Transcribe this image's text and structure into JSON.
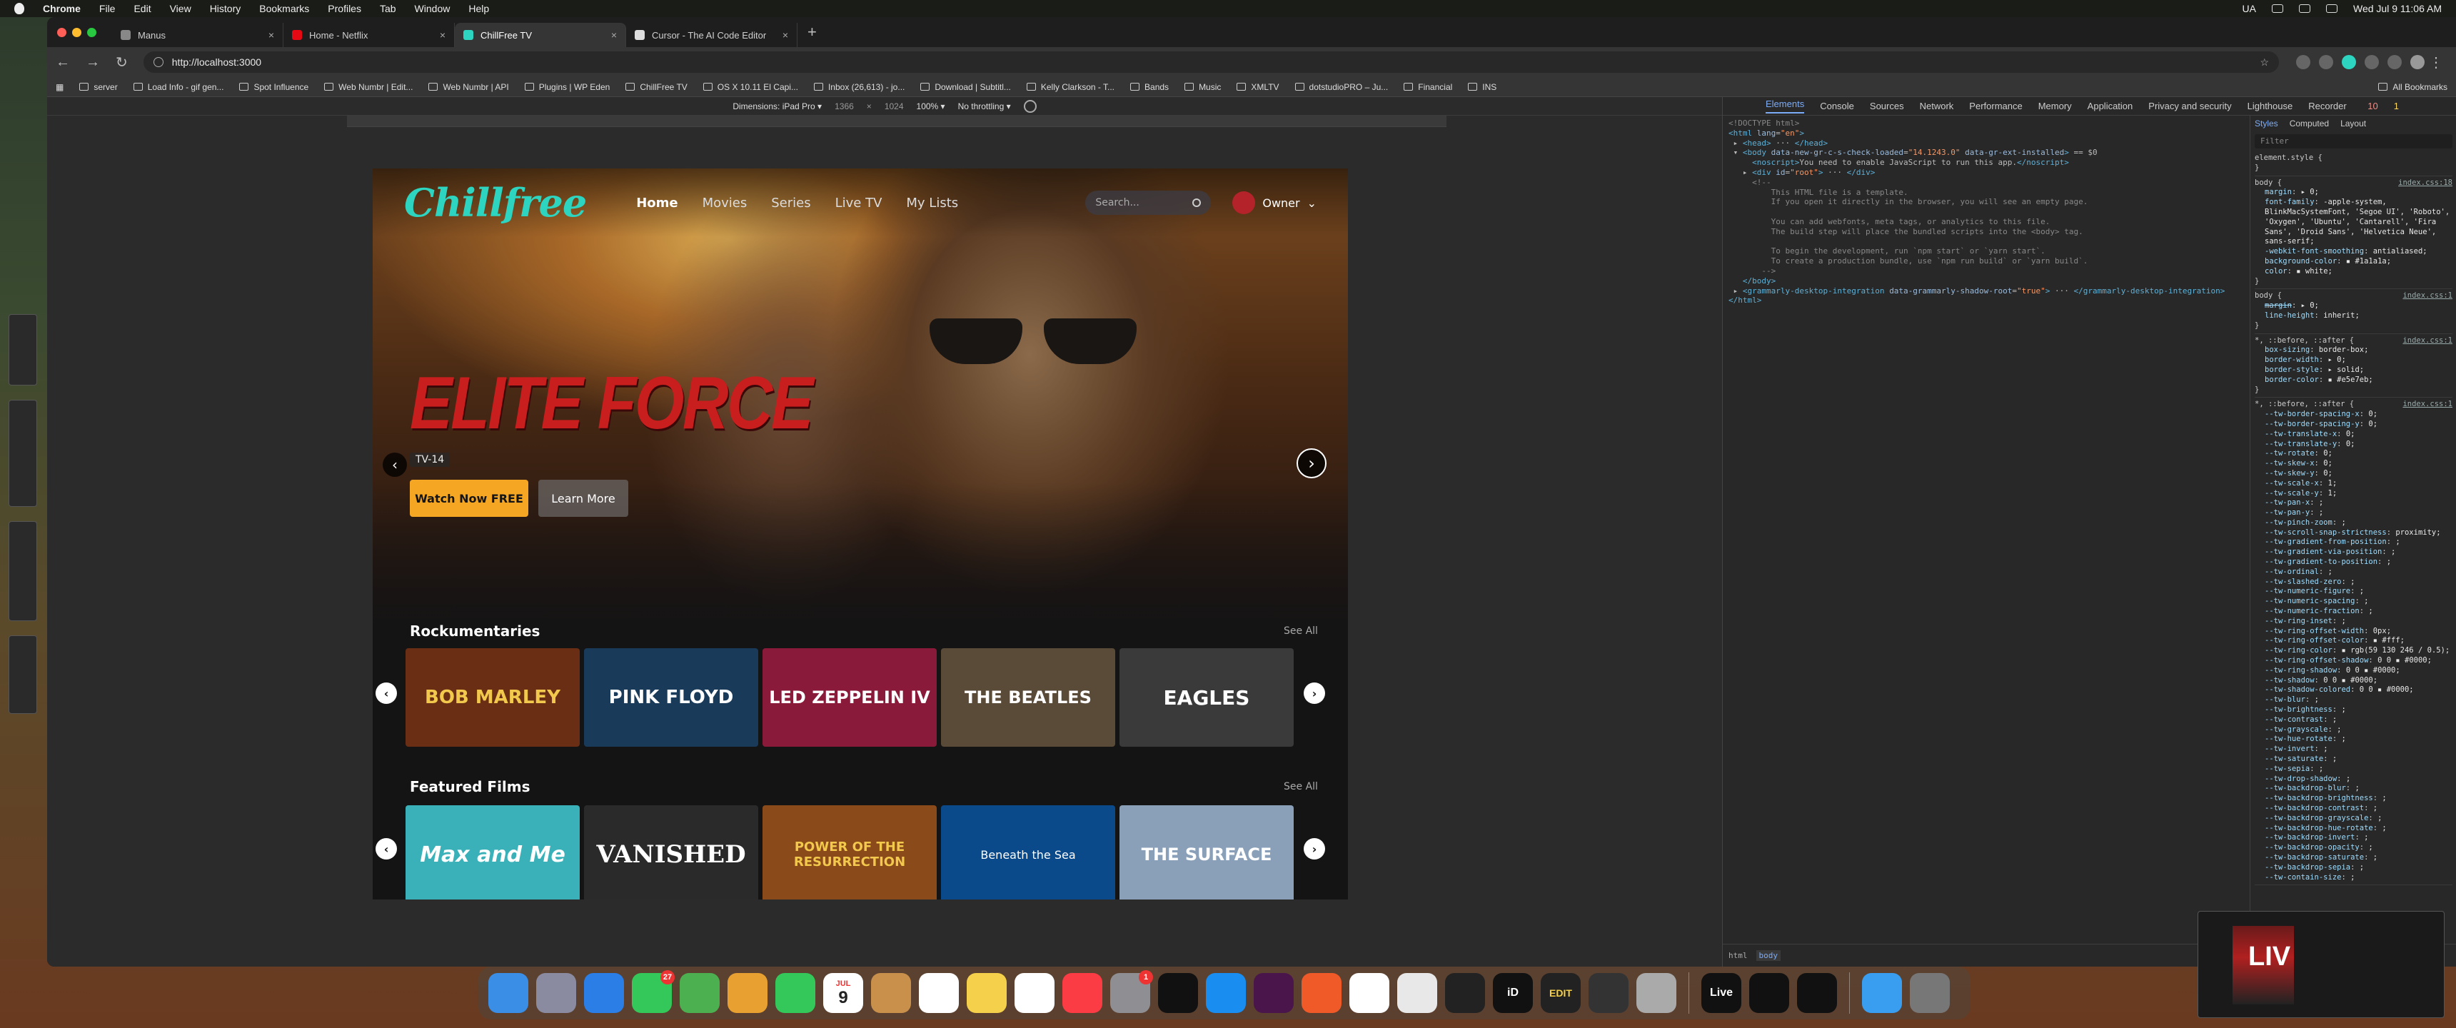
{
  "menubar": {
    "app": "Chrome",
    "items": [
      "File",
      "Edit",
      "View",
      "History",
      "Bookmarks",
      "Profiles",
      "Tab",
      "Window",
      "Help"
    ],
    "lang": "UA",
    "clock": "Wed Jul 9  11:06 AM"
  },
  "tabs": [
    {
      "label": "Manus",
      "color": "#888888"
    },
    {
      "label": "Home - Netflix",
      "color": "#e50914"
    },
    {
      "label": "ChillFree TV",
      "color": "#2dd4bf"
    },
    {
      "label": "Cursor - The AI Code Editor",
      "color": "#dddddd"
    }
  ],
  "url": "http://localhost:3000",
  "bookmarks": [
    "server",
    "Load Info - gif gen...",
    "Spot Influence",
    "Web Numbr | Edit...",
    "Web Numbr | API",
    "Plugins | WP Eden",
    "ChillFree TV",
    "OS X 10.11 El Capi...",
    "Inbox (26,613) - jo...",
    "Download | Subtitl...",
    "Kelly Clarkson - T...",
    "Bands",
    "Music",
    "XMLTV",
    "dotstudioPRO – Ju...",
    "Financial",
    "INS"
  ],
  "all_bookmarks": "All Bookmarks",
  "devtoolbar": {
    "dimensions": "Dimensions: iPad Pro ▾",
    "width": "1366",
    "x": "×",
    "height": "1024",
    "zoom": "100% ▾",
    "throttle": "No throttling ▾"
  },
  "app": {
    "logo": "Chillfree",
    "nav": [
      "Home",
      "Movies",
      "Series",
      "Live TV",
      "My Lists"
    ],
    "search_placeholder": "Search...",
    "user": "Owner",
    "hero_title": "ELITE FORCE",
    "rating": "TV-14",
    "watch": "Watch Now FREE",
    "learn": "Learn More",
    "see_all": "See All",
    "rows": [
      {
        "title": "Rockumentaries",
        "posters": [
          "BOB MARLEY",
          "PINK FLOYD",
          "LED ZEPPELIN IV",
          "THE BEATLES",
          "EAGLES"
        ],
        "colors": [
          "#6a2e14",
          "#1a3a5a",
          "#8a1a3a",
          "#5a4a38",
          "#3a3a3a"
        ]
      },
      {
        "title": "Featured Films",
        "posters": [
          "Max and Me",
          "VANISHED",
          "POWER OF THE RESURRECTION",
          "Beneath the Sea",
          "THE SURFACE"
        ],
        "colors": [
          "#3ab0b8",
          "#2a2a2a",
          "#8a4a1a",
          "#0a4a8a",
          "#8aa0b8"
        ]
      }
    ]
  },
  "devtools": {
    "tabs": [
      "Elements",
      "Console",
      "Sources",
      "Network",
      "Performance",
      "Memory",
      "Application",
      "Privacy and security",
      "Lighthouse",
      "Recorder"
    ],
    "errors": "10",
    "warnings": "1",
    "style_tabs": [
      "Styles",
      "Computed",
      "Layout"
    ],
    "filter": "Filter",
    "crumbs": [
      "html",
      "body"
    ]
  },
  "pip": {
    "label": "LIV"
  },
  "dock": {
    "messages_badge": "27",
    "settings_badge": "1",
    "cal_month": "JUL",
    "cal_day": "9",
    "edit": "EDIT",
    "live": "Live",
    "id": "iD"
  }
}
